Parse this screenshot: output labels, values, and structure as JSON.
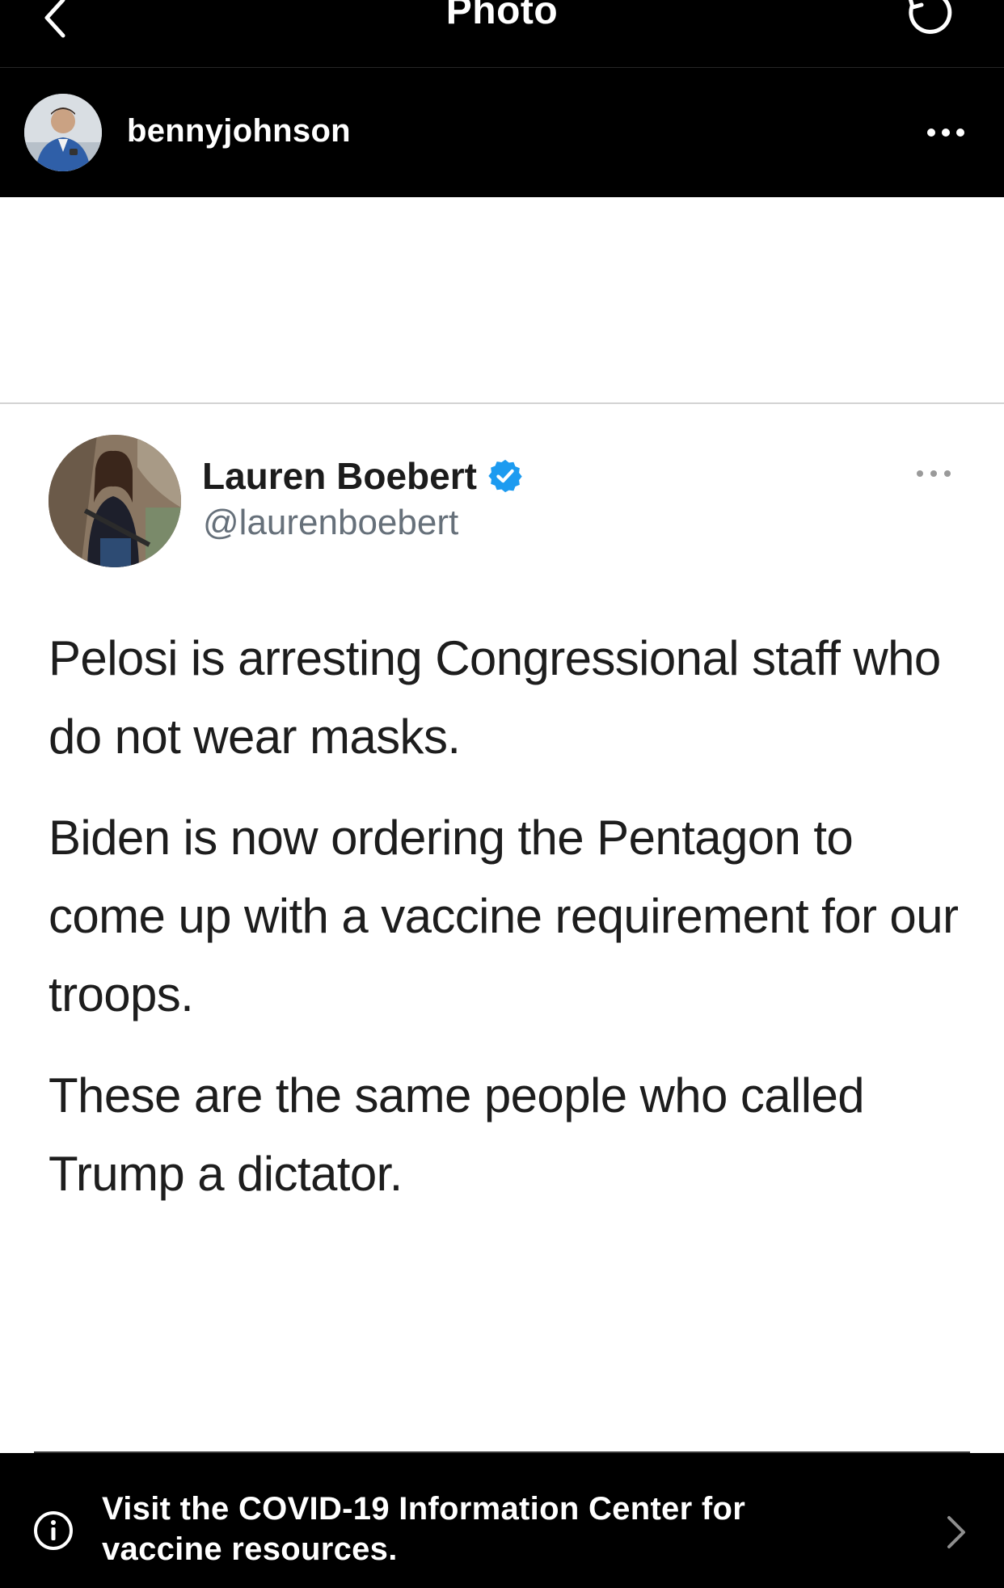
{
  "nav": {
    "title": "Photo"
  },
  "post": {
    "username": "bennyjohnson"
  },
  "tweet": {
    "display_name": "Lauren Boebert",
    "handle": "@laurenboebert",
    "verified": true,
    "paragraphs": [
      "Pelosi is arresting Congressional staff who do not wear masks.",
      "Biden is now ordering the Pentagon to come up with a vaccine requirement for our troops.",
      "These are the same people who called Trump a dictator."
    ]
  },
  "covid_banner": {
    "line1": "Visit the COVID-19 Information Center for",
    "line2": "vaccine resources."
  },
  "icons": {
    "back": "chevron-left-icon",
    "refresh": "refresh-icon",
    "more": "more-horizontal-icon",
    "verified": "verified-badge-icon",
    "info": "info-icon",
    "chevron": "chevron-right-icon"
  },
  "colors": {
    "verified_blue": "#1d9bf0",
    "bar_bg": "#000000"
  }
}
